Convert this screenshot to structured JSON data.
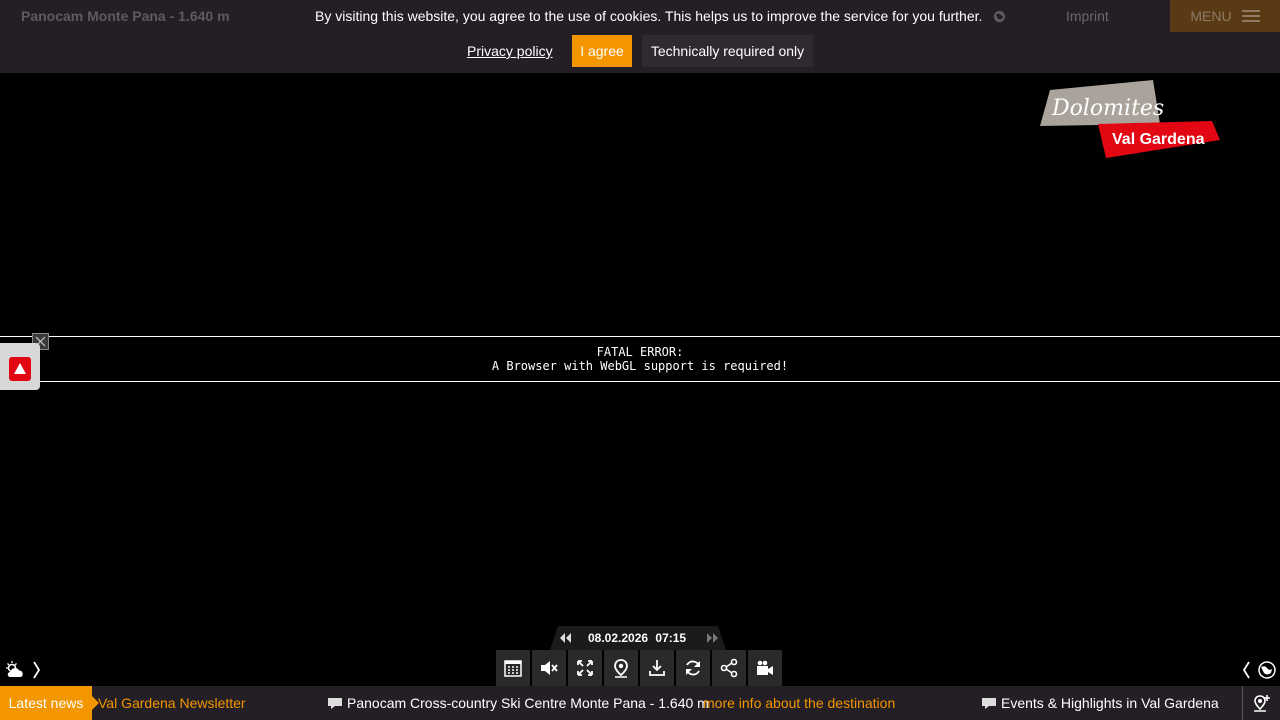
{
  "header": {
    "title": "Panocam Monte Pana - 1.640 m",
    "imprint": "Imprint",
    "menu_label": "MENU"
  },
  "cookie": {
    "text": "By visiting this website, you agree to the use of cookies. This helps us to improve the service for you further.",
    "privacy": "Privacy policy",
    "agree": "I agree",
    "required_only": "Technically required only"
  },
  "logo": {
    "line1": "Dolomites",
    "line2": "Val Gardena"
  },
  "error": {
    "title": "FATAL ERROR:",
    "message": "A Browser with WebGL support is required!"
  },
  "timeline": {
    "date": "08.02.2026",
    "time": "07:15"
  },
  "toolbar": {
    "buttons": [
      "calendar-icon",
      "mute-icon",
      "fullscreen-icon",
      "location-icon",
      "download-icon",
      "refresh-icon",
      "share-icon",
      "camera-icon"
    ]
  },
  "ticker": {
    "label": "Latest news",
    "item1": "Val Gardena Newsletter",
    "item2": "Panocam Cross-country Ski Centre Monte Pana - 1.640 m",
    "item2_link": "more info about the destination",
    "item3": "Events & Highlights in Val Gardena"
  },
  "colors": {
    "accent": "#f39600",
    "bar": "#231f24",
    "logo_red": "#e30613",
    "logo_grey": "#a9a39b"
  }
}
